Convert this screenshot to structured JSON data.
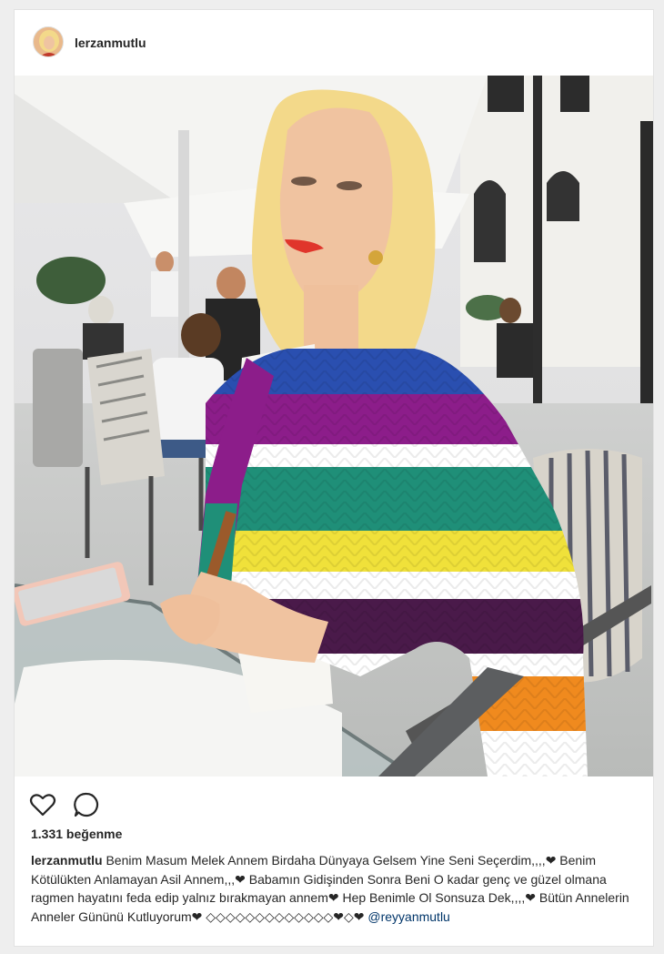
{
  "post": {
    "username": "lerzanmutlu",
    "avatar_icon": "profile-avatar",
    "likes_text": "1.331 beğenme",
    "caption_user": "lerzanmutlu",
    "caption_text": "Benim Masum Melek Annem Birdaha Dünyaya Gelsem Yine Seni Seçerdim,,,,❤ Benim Kötülükten Anlamayan Asil Annem,,,❤ Babamın Gidişinden Sonra Beni O kadar genç ve güzel olmana ragmen hayatını feda edip yalnız bırakmayan annem❤ Hep Benimle Ol Sonsuza Dek,,,,❤ Bütün Annelerin Anneler Gününü Kutluyorum❤ ◇◇◇◇◇◇◇◇◇◇◇◇◇❤◇❤ ",
    "caption_mention": "@reyyanmutlu"
  },
  "icons": {
    "like": "heart-icon",
    "comment": "comment-icon"
  },
  "colors": {
    "cardigan_stripes": [
      "#2a4fb0",
      "#8c1d8a",
      "#1f8f78",
      "#f0e13a",
      "#ffffff",
      "#4a1a4a",
      "#f08a1e"
    ],
    "lipstick": "#e0352b",
    "hair": "#f3d98a"
  }
}
